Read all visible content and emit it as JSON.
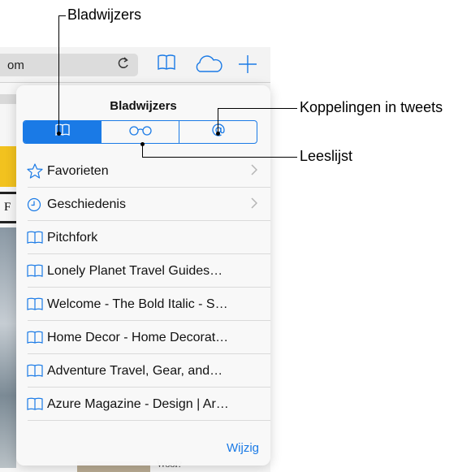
{
  "callouts": {
    "bladwijzers": "Bladwijzers",
    "koppelingen": "Koppelingen in tweets",
    "leeslijst": "Leeslijst"
  },
  "browser": {
    "url_fragment": "om",
    "reload_glyph": "C",
    "page_fragments": [
      "F",
      "Wool?"
    ]
  },
  "popover": {
    "title": "Bladwijzers",
    "segments": [
      {
        "name": "bookmarks",
        "icon": "book-icon",
        "active": true
      },
      {
        "name": "reading-list",
        "icon": "glasses-icon",
        "active": false
      },
      {
        "name": "shared-links",
        "icon": "at-sign-icon",
        "active": false
      }
    ],
    "items": [
      {
        "label": "Favorieten",
        "icon": "star-icon",
        "chevron": true
      },
      {
        "label": "Geschiedenis",
        "icon": "clock-icon",
        "chevron": true
      },
      {
        "label": "Pitchfork",
        "icon": "book-icon",
        "chevron": false
      },
      {
        "label": "Lonely Planet Travel Guides…",
        "icon": "book-icon",
        "chevron": false
      },
      {
        "label": "Welcome - The Bold Italic - S…",
        "icon": "book-icon",
        "chevron": false
      },
      {
        "label": "Home Decor - Home Decorat…",
        "icon": "book-icon",
        "chevron": false
      },
      {
        "label": "Adventure Travel, Gear, and…",
        "icon": "book-icon",
        "chevron": false
      },
      {
        "label": "Azure Magazine - Design | Ar…",
        "icon": "book-icon",
        "chevron": false
      }
    ],
    "edit_label": "Wijzig"
  },
  "colors": {
    "accent": "#1a7ae6"
  }
}
